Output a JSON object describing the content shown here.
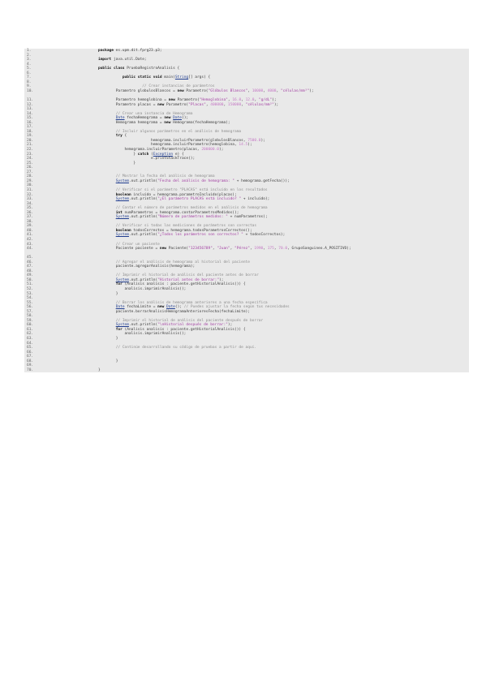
{
  "colors": {
    "background": "#e9e9e9",
    "keyword": "#111111",
    "comment": "#8c8c8c",
    "string": "#a340a3",
    "number": "#c478c4",
    "type_link": "#1f3c8f",
    "plain": "#3a3a3a",
    "line_number": "#666666"
  },
  "lines": [
    {
      "n": "1.",
      "tokens": [
        [
          "kw",
          "package"
        ],
        [
          "pl",
          " es.upm.dit.fprg23.p3;"
        ]
      ]
    },
    {
      "n": "2.",
      "tokens": []
    },
    {
      "n": "3.",
      "tokens": [
        [
          "kw",
          "import"
        ],
        [
          "pl",
          " java.util.Date;"
        ]
      ]
    },
    {
      "n": "4.",
      "tokens": []
    },
    {
      "n": "5.",
      "tokens": [
        [
          "kw",
          "public class"
        ],
        [
          "pl",
          " PruebaRegistroAnalisis {"
        ]
      ]
    },
    {
      "n": "6.",
      "tokens": []
    },
    {
      "n": "7.",
      "tokens": [
        [
          "pl",
          "           "
        ],
        [
          "kw",
          "public static void"
        ],
        [
          "pl",
          " main("
        ],
        [
          "ty",
          "String"
        ],
        [
          "pl",
          "[] args) {"
        ]
      ]
    },
    {
      "n": "8.",
      "tokens": []
    },
    {
      "n": "9.",
      "tokens": [
        [
          "pl",
          "                    "
        ],
        [
          "cm",
          "// Crear instancias de parámetros"
        ]
      ]
    },
    {
      "n": "10.",
      "wrap": true,
      "tokens": [
        [
          "pl",
          "        Parametro globulosBlancos = "
        ],
        [
          "kw",
          "new"
        ],
        [
          "pl",
          " Parametro("
        ],
        [
          "st",
          "\"Glóbulos Blancos\""
        ],
        [
          "pl",
          ", "
        ],
        [
          "nm",
          "10000"
        ],
        [
          "pl",
          ", "
        ],
        [
          "nm",
          "4000"
        ],
        [
          "pl",
          ", "
        ],
        [
          "st",
          "\"células/mm³\""
        ],
        [
          "pl",
          ");"
        ]
      ]
    },
    {
      "n": "11.",
      "tokens": [
        [
          "pl",
          "        Parametro hemoglobina = "
        ],
        [
          "kw",
          "new"
        ],
        [
          "pl",
          " Parametro("
        ],
        [
          "st",
          "\"Hemoglobina\""
        ],
        [
          "pl",
          ", "
        ],
        [
          "nm",
          "16.0"
        ],
        [
          "pl",
          ", "
        ],
        [
          "nm",
          "12.0"
        ],
        [
          "pl",
          ", "
        ],
        [
          "st",
          "\"g/dL\""
        ],
        [
          "pl",
          ");"
        ]
      ]
    },
    {
      "n": "12.",
      "tokens": [
        [
          "pl",
          "        Parametro placas = "
        ],
        [
          "kw",
          "new"
        ],
        [
          "pl",
          " Parametro("
        ],
        [
          "st",
          "\"Placas\""
        ],
        [
          "pl",
          ", "
        ],
        [
          "nm",
          "400000"
        ],
        [
          "pl",
          ", "
        ],
        [
          "nm",
          "150000"
        ],
        [
          "pl",
          ", "
        ],
        [
          "st",
          "\"células/mm³\""
        ],
        [
          "pl",
          ");"
        ]
      ]
    },
    {
      "n": "13.",
      "tokens": []
    },
    {
      "n": "14.",
      "tokens": [
        [
          "pl",
          "        "
        ],
        [
          "cm",
          "// Crear una instancia de Hemograma"
        ]
      ]
    },
    {
      "n": "15.",
      "tokens": [
        [
          "pl",
          "        "
        ],
        [
          "ty",
          "Date"
        ],
        [
          "pl",
          " fechaHemograma = "
        ],
        [
          "kw",
          "new"
        ],
        [
          "pl",
          " "
        ],
        [
          "ty",
          "Date"
        ],
        [
          "pl",
          "();"
        ]
      ]
    },
    {
      "n": "16.",
      "tokens": [
        [
          "pl",
          "        Hemograma hemograma = "
        ],
        [
          "kw",
          "new"
        ],
        [
          "pl",
          " Hemograma(fechaHemograma);"
        ]
      ]
    },
    {
      "n": "17.",
      "tokens": []
    },
    {
      "n": "18.",
      "tokens": [
        [
          "pl",
          "        "
        ],
        [
          "cm",
          "// Incluir algunos parámetros en el análisis de hemograma"
        ]
      ]
    },
    {
      "n": "19.",
      "tokens": [
        [
          "pl",
          "        "
        ],
        [
          "kw",
          "try"
        ],
        [
          "pl",
          " {"
        ]
      ]
    },
    {
      "n": "20.",
      "tokens": [
        [
          "pl",
          "                        hemograma.incluirParametro(globulosBlancos, "
        ],
        [
          "nm",
          "7500.0"
        ],
        [
          "pl",
          ");"
        ]
      ]
    },
    {
      "n": "21.",
      "tokens": [
        [
          "pl",
          "                        hemograma.incluirParametro(hemoglobina, "
        ],
        [
          "nm",
          "14.5"
        ],
        [
          "pl",
          ");"
        ]
      ]
    },
    {
      "n": "22.",
      "tokens": [
        [
          "pl",
          "            hemograma.incluirParametro(placas, "
        ],
        [
          "nm",
          "200000.0"
        ],
        [
          "pl",
          ");"
        ]
      ]
    },
    {
      "n": "23.",
      "tokens": [
        [
          "pl",
          "                } "
        ],
        [
          "kw",
          "catch"
        ],
        [
          "pl",
          " ("
        ],
        [
          "ty",
          "Exception"
        ],
        [
          "pl",
          " e) {"
        ]
      ]
    },
    {
      "n": "24.",
      "tokens": [
        [
          "pl",
          "                        e.printStackTrace();"
        ]
      ]
    },
    {
      "n": "25.",
      "tokens": [
        [
          "pl",
          "                }"
        ]
      ]
    },
    {
      "n": "26.",
      "tokens": []
    },
    {
      "n": "27.",
      "tokens": []
    },
    {
      "n": "28.",
      "tokens": [
        [
          "pl",
          "        "
        ],
        [
          "cm",
          "// Mostrar la fecha del análisis de hemograma"
        ]
      ]
    },
    {
      "n": "29.",
      "tokens": [
        [
          "pl",
          "        "
        ],
        [
          "ty",
          "System"
        ],
        [
          "pl",
          ".out.println("
        ],
        [
          "st",
          "\"Fecha del análisis de hemograma: \""
        ],
        [
          "pl",
          " + hemograma.getFecha());"
        ]
      ]
    },
    {
      "n": "30.",
      "tokens": []
    },
    {
      "n": "31.",
      "tokens": [
        [
          "pl",
          "        "
        ],
        [
          "cm",
          "// Verificar si el parámetro \"PLACAS\" está incluido en los resultados"
        ]
      ]
    },
    {
      "n": "32.",
      "tokens": [
        [
          "pl",
          "        "
        ],
        [
          "kw",
          "boolean"
        ],
        [
          "pl",
          " incluido = hemograma.parametroIncluido(placas);"
        ]
      ]
    },
    {
      "n": "33.",
      "tokens": [
        [
          "pl",
          "        "
        ],
        [
          "ty",
          "System"
        ],
        [
          "pl",
          ".out.println("
        ],
        [
          "st",
          "\"¿El parámetro PLACAS está incluido? \""
        ],
        [
          "pl",
          " + incluido);"
        ]
      ]
    },
    {
      "n": "34.",
      "tokens": []
    },
    {
      "n": "35.",
      "tokens": [
        [
          "pl",
          "        "
        ],
        [
          "cm",
          "// Contar el número de parámetros medidos en el análisis de hemograma"
        ]
      ]
    },
    {
      "n": "36.",
      "tokens": [
        [
          "pl",
          "        "
        ],
        [
          "kw",
          "int"
        ],
        [
          "pl",
          " numParametros = hemograma.contarParametrosMedidos();"
        ]
      ]
    },
    {
      "n": "37.",
      "tokens": [
        [
          "pl",
          "        "
        ],
        [
          "ty",
          "System"
        ],
        [
          "pl",
          ".out.println("
        ],
        [
          "st",
          "\"Número de parámetros medidos: \""
        ],
        [
          "pl",
          " + numParametros);"
        ]
      ]
    },
    {
      "n": "38.",
      "tokens": []
    },
    {
      "n": "39.",
      "tokens": [
        [
          "pl",
          "        "
        ],
        [
          "cm",
          "// Verificar si todas las mediciones de parámetros son correctas"
        ]
      ]
    },
    {
      "n": "40.",
      "tokens": [
        [
          "pl",
          "        "
        ],
        [
          "kw",
          "boolean"
        ],
        [
          "pl",
          " todosCorrectos = hemograma.todosParametrosCorrectos();"
        ]
      ]
    },
    {
      "n": "41.",
      "tokens": [
        [
          "pl",
          "        "
        ],
        [
          "ty",
          "System"
        ],
        [
          "pl",
          ".out.println("
        ],
        [
          "st",
          "\"¿Todos los parámetros son correctos? \""
        ],
        [
          "pl",
          " + todosCorrectos);"
        ]
      ]
    },
    {
      "n": "42.",
      "tokens": []
    },
    {
      "n": "43.",
      "tokens": [
        [
          "pl",
          "        "
        ],
        [
          "cm",
          "// Crear un paciente"
        ]
      ]
    },
    {
      "n": "44.",
      "wrap": true,
      "tokens": [
        [
          "pl",
          "        Paciente paciente = "
        ],
        [
          "kw",
          "new"
        ],
        [
          "pl",
          " Paciente("
        ],
        [
          "st",
          "\"123456789\""
        ],
        [
          "pl",
          ", "
        ],
        [
          "st",
          "\"Juan\""
        ],
        [
          "pl",
          ", "
        ],
        [
          "st",
          "\"Pérez\""
        ],
        [
          "pl",
          ", "
        ],
        [
          "nm",
          "1990"
        ],
        [
          "pl",
          ", "
        ],
        [
          "nm",
          "175"
        ],
        [
          "pl",
          ", "
        ],
        [
          "nm",
          "70.0"
        ],
        [
          "pl",
          ", GrupoSanguineo.A_POSITIVO);"
        ]
      ]
    },
    {
      "n": "45.",
      "tokens": []
    },
    {
      "n": "46.",
      "tokens": [
        [
          "pl",
          "        "
        ],
        [
          "cm",
          "// Agregar el análisis de hemograma al historial del paciente"
        ]
      ]
    },
    {
      "n": "47.",
      "tokens": [
        [
          "pl",
          "        paciente.agregarAnalisis(hemograma);"
        ]
      ]
    },
    {
      "n": "48.",
      "tokens": []
    },
    {
      "n": "49.",
      "tokens": [
        [
          "pl",
          "        "
        ],
        [
          "cm",
          "// Imprimir el historial de análisis del paciente antes de borrar"
        ]
      ]
    },
    {
      "n": "50.",
      "tokens": [
        [
          "pl",
          "        "
        ],
        [
          "ty",
          "System"
        ],
        [
          "pl",
          ".out.println("
        ],
        [
          "st",
          "\"Historial antes de borrar:\""
        ],
        [
          "pl",
          ");"
        ]
      ]
    },
    {
      "n": "51.",
      "tokens": [
        [
          "pl",
          "        "
        ],
        [
          "kw",
          "for"
        ],
        [
          "pl",
          " (Analisis analisis : paciente.getHistorialAnalisis()) {"
        ]
      ]
    },
    {
      "n": "52.",
      "tokens": [
        [
          "pl",
          "            analisis.imprimirAnalisis();"
        ]
      ]
    },
    {
      "n": "53.",
      "tokens": [
        [
          "pl",
          "        }"
        ]
      ]
    },
    {
      "n": "54.",
      "tokens": []
    },
    {
      "n": "55.",
      "tokens": [
        [
          "pl",
          "        "
        ],
        [
          "cm",
          "// Borrar los análisis de hemograma anteriores a una fecha específica"
        ]
      ]
    },
    {
      "n": "56.",
      "tokens": [
        [
          "pl",
          "        "
        ],
        [
          "ty",
          "Date"
        ],
        [
          "pl",
          " fechaLimite = "
        ],
        [
          "kw",
          "new"
        ],
        [
          "pl",
          " "
        ],
        [
          "ty",
          "Date"
        ],
        [
          "pl",
          "(); "
        ],
        [
          "cm",
          "// Puedes ajustar la fecha según tus necesidades"
        ]
      ]
    },
    {
      "n": "57.",
      "tokens": [
        [
          "pl",
          "        paciente.borrarAnalisisHemogramaAnterioresFecha(fechaLimite);"
        ]
      ]
    },
    {
      "n": "58.",
      "tokens": []
    },
    {
      "n": "59.",
      "tokens": [
        [
          "pl",
          "        "
        ],
        [
          "cm",
          "// Imprimir el historial de análisis del paciente después de borrar"
        ]
      ]
    },
    {
      "n": "60.",
      "tokens": [
        [
          "pl",
          "        "
        ],
        [
          "ty",
          "System"
        ],
        [
          "pl",
          ".out.println("
        ],
        [
          "st",
          "\"\\nHistorial después de borrar:\""
        ],
        [
          "pl",
          ");"
        ]
      ]
    },
    {
      "n": "61.",
      "tokens": [
        [
          "pl",
          "        "
        ],
        [
          "kw",
          "for"
        ],
        [
          "pl",
          " (Analisis analisis : paciente.getHistorialAnalisis()) {"
        ]
      ]
    },
    {
      "n": "62.",
      "tokens": [
        [
          "pl",
          "            analisis.imprimirAnalisis();"
        ]
      ]
    },
    {
      "n": "63.",
      "tokens": [
        [
          "pl",
          "        }"
        ]
      ]
    },
    {
      "n": "64.",
      "tokens": []
    },
    {
      "n": "65.",
      "tokens": [
        [
          "pl",
          "        "
        ],
        [
          "cm",
          "// Continúe desarrollando su código de pruebas a partir de aquí."
        ]
      ]
    },
    {
      "n": "66.",
      "tokens": []
    },
    {
      "n": "67.",
      "tokens": []
    },
    {
      "n": "68.",
      "tokens": [
        [
          "pl",
          "        }"
        ]
      ]
    },
    {
      "n": "69.",
      "tokens": []
    },
    {
      "n": "70.",
      "tokens": [
        [
          "pl",
          "}"
        ]
      ]
    }
  ]
}
